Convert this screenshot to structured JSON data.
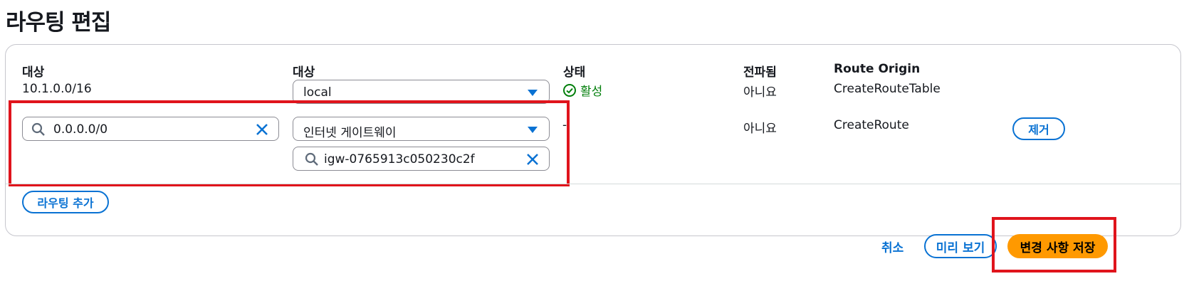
{
  "page": {
    "title": "라우팅 편집"
  },
  "table": {
    "headers": {
      "destination": "대상",
      "target": "대상",
      "status": "상태",
      "propagated": "전파됨",
      "route_origin": "Route Origin"
    },
    "rows": [
      {
        "destination": "10.1.0.0/16",
        "target_type": "local",
        "status": "활성",
        "propagated": "아니요",
        "route_origin": "CreateRouteTable"
      },
      {
        "destination": "0.0.0.0/0",
        "target_type": "인터넷 게이트웨이",
        "target_id": "igw-0765913c050230c2f",
        "status": "-",
        "propagated": "아니요",
        "route_origin": "CreateRoute",
        "remove_label": "제거"
      }
    ]
  },
  "add_route_label": "라우팅 추가",
  "footer": {
    "cancel_label": "취소",
    "preview_label": "미리 보기",
    "save_label": "변경 사항 저장"
  },
  "colors": {
    "accent": "#0972d3",
    "primary_button": "#ff9900",
    "success": "#037f0c",
    "highlight_box": "#e0141c"
  }
}
